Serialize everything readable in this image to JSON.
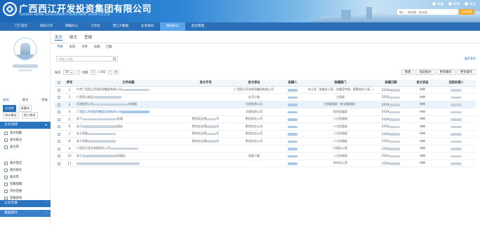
{
  "banner": {
    "company_cn": "广西西江开发投资集团有限公司",
    "company_en": "GUANGXI XIJIANG DEVELOPMENTS INVESTMENT GROUP CO.,LTD.",
    "links": [
      "收藏",
      "帮助",
      "退出"
    ],
    "search_placeholder": "输入，搜标题，查全部",
    "search_button": "全站搜索"
  },
  "nav": {
    "items": [
      "门户首页",
      "协同工作",
      "邮箱办公",
      "工作台",
      "西江大数据",
      "业务协同",
      "协同办公",
      "后台管理"
    ],
    "active_index": 6
  },
  "sidebar": {
    "tabs": [
      "发文",
      "收文",
      "签报"
    ],
    "row1": [
      "公文库",
      "收藏夹"
    ],
    "row2": [
      "待办事宜",
      "我已审阅"
    ],
    "section1": "公文流转",
    "group1": [
      "发文拟稿",
      "发文核文",
      "发文库"
    ],
    "group2": [
      "收文登记",
      "收文核文",
      "收文库"
    ],
    "group3": [
      "签报拟稿",
      "待办签报",
      "签报查询",
      "签报库"
    ],
    "section2": "公文交换",
    "section3": "基础操作"
  },
  "main": {
    "tabs": [
      "发文",
      "收文",
      "签报"
    ],
    "subtabs": [
      "不限",
      "查阅",
      "待审",
      "拟稿",
      "回复"
    ],
    "filter_placeholder": "请输入标题",
    "expand": "展开条件",
    "toolbar": {
      "per_page_label": "每页",
      "per_page": "10",
      "goto_label": "到第",
      "page": "1",
      "total": "/ 202",
      "buttons": [
        "新建",
        "发起报办",
        "更改编号",
        "更多操作"
      ]
    },
    "columns": [
      "序号",
      "文件标题",
      "发文字号",
      "发文单位",
      "拟稿人",
      "拟稿部门",
      "拟稿日期",
      "发文状态",
      "当前处理人"
    ],
    "rows": [
      {
        "no": "1",
        "title": "中共广西西江开发投资集团有限公司",
        "doc_no": "",
        "unit": "广西西江开发投资集团有限公司",
        "dept": "办公室（党委办公室、党委宣传部、董事会办公室、改革办）",
        "date": "2019",
        "status": "待审"
      },
      {
        "no": "2",
        "title": "广西西江航运",
        "doc_no": "",
        "unit": "红河二城",
        "dept": "工程部",
        "date": "2019",
        "status": "待审"
      },
      {
        "no": "3",
        "title": "河池投资公司",
        "title_tail": "的通知",
        "doc_no": "",
        "unit": "河池投资公司",
        "dept": "工程管理部（安全管理部）",
        "date": "2019",
        "status": "待审"
      },
      {
        "no": "4",
        "title": "广西西江开发投资集团河池投资公司",
        "doc_no": "",
        "unit": "河池投资公司",
        "dept": "投资发展部",
        "date": "2019",
        "status": "待审"
      },
      {
        "no": "5",
        "title": "关于",
        "title_tail": "处理",
        "doc_no": "黔铝实业预",
        "doc_tail": "号",
        "unit": "黔铝实业公司",
        "dept": "人力资源部",
        "date": "2019",
        "status": "待审"
      },
      {
        "no": "6",
        "title": "关于",
        "title_tail": "报告",
        "doc_no": "黔铝实业预",
        "doc_tail": "号",
        "unit": "黔铝实业公司",
        "dept": "人力资源部",
        "date": "2019",
        "status": "待审"
      },
      {
        "no": "7",
        "title": "关于同意",
        "doc_no": "黔铝实业预",
        "doc_tail": "号",
        "unit": "黔铝实业公司",
        "dept": "人力资源部",
        "date": "2019",
        "status": "待审"
      },
      {
        "no": "8",
        "title": "关于同意",
        "doc_no": "黔铝实业预",
        "doc_tail": "号",
        "unit": "黔铝实业公司",
        "dept": "人力资源部",
        "date": "2019",
        "status": "待审"
      },
      {
        "no": "9",
        "title": "广西西江铝业有限责任公司",
        "doc_no": "",
        "unit": "",
        "dept": "行政办公室",
        "date": "2019",
        "status": "待审"
      },
      {
        "no": "10",
        "title": "关于",
        "title_tail": "的报告",
        "doc_no": "",
        "unit": "西南二城",
        "dept": "人力资源部",
        "date": "2019",
        "status": "待审"
      },
      {
        "no": "11",
        "title": "",
        "doc_no": "",
        "unit": "",
        "dept": "综合办公室",
        "date": "2019",
        "status": "待审"
      }
    ]
  },
  "colors": {
    "nav_bg": "#2a6fb8",
    "nav_active": "#5aa4ea",
    "section_bg": "#2c73bf",
    "search_button": "#f5a623",
    "link": "#1c64b2"
  }
}
